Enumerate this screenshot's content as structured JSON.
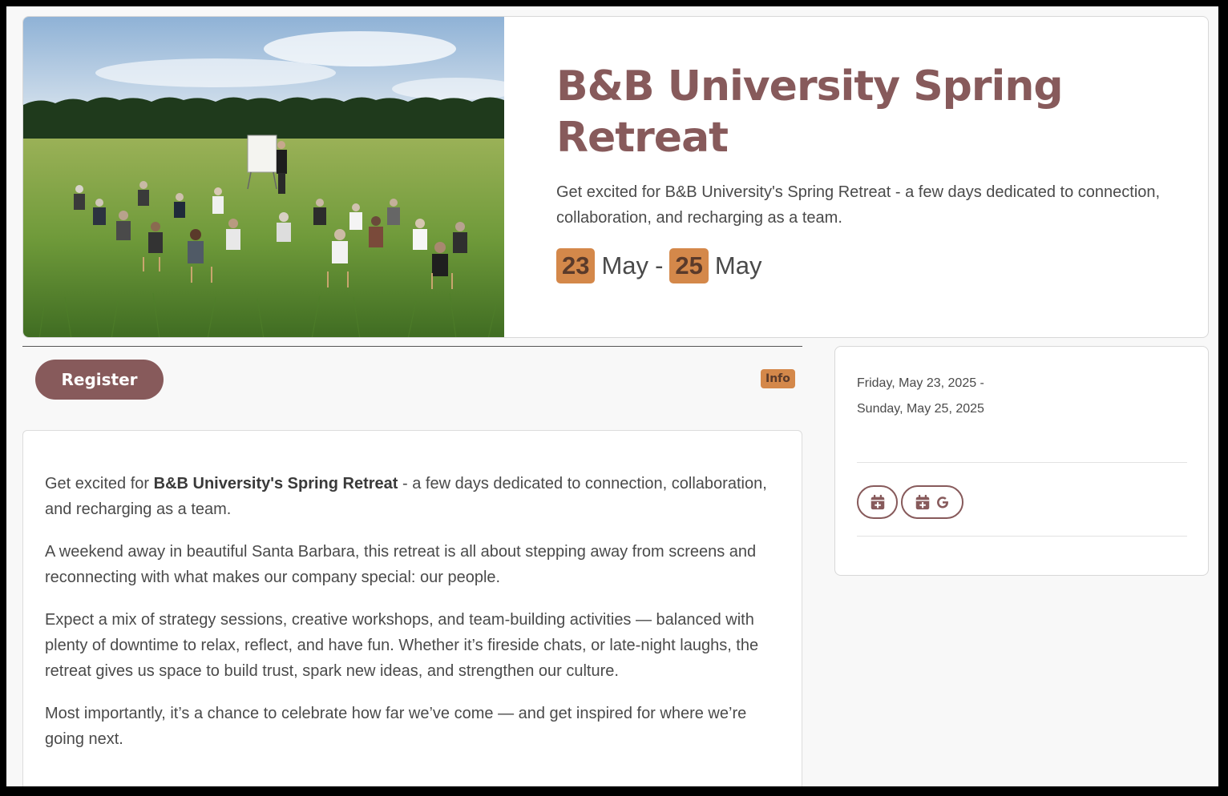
{
  "hero": {
    "title": "B&B University Spring Retreat",
    "description": "Get excited for B&B University's Spring Retreat - a few days dedicated to connection, collaboration, and recharging as a team.",
    "start_day": "23",
    "start_month": "May",
    "separator": "-",
    "end_day": "25",
    "end_month": "May",
    "image_alt": "Group of people seated in chairs in a grassy field listening to a presenter"
  },
  "actions": {
    "register_label": "Register",
    "info_label": "Info"
  },
  "details": {
    "intro_prefix": "Get excited for ",
    "intro_bold": "B&B University's Spring Retreat",
    "intro_suffix": " - a few days dedicated to connection, collaboration, and recharging as a team.",
    "p2": "A weekend away in beautiful Santa Barbara, this retreat is all about stepping away from screens and reconnecting with what makes our company special: our people.",
    "p3": "Expect a mix of strategy sessions, creative workshops, and team-building activities — balanced with plenty of downtime to relax, reflect, and have fun. Whether it’s fireside chats, or late-night laughs, the retreat gives us space to build trust, spark new ideas, and strengthen our culture.",
    "p4": "Most importantly, it’s a chance to celebrate how far we’ve come — and get inspired for where we’re going next."
  },
  "sidebar": {
    "date_start": "Friday, May 23, 2025 -",
    "date_end": "Sunday, May 25, 2025",
    "buttons": [
      {
        "icon": "calendar-plus-icon"
      },
      {
        "icon": "google-calendar-icon"
      }
    ]
  },
  "colors": {
    "brand": "#875a5b",
    "accent": "#d4884a",
    "background": "#f8f8f8"
  }
}
